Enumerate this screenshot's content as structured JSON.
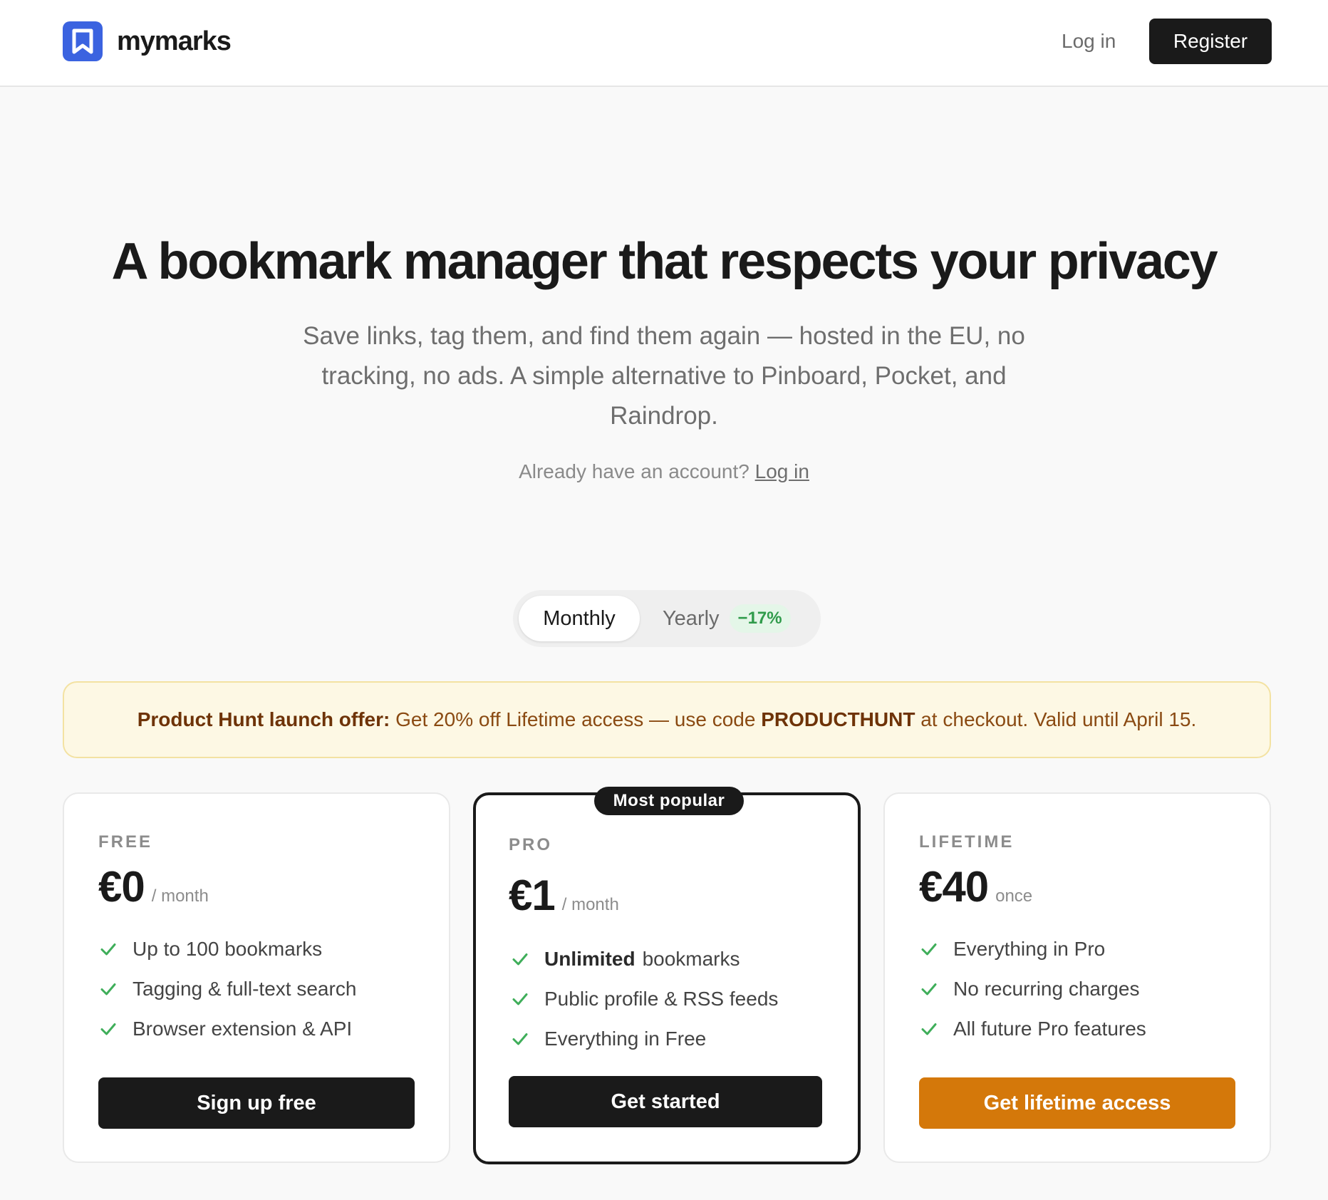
{
  "brand": {
    "name": "mymarks",
    "logo_color": "#3b63e0"
  },
  "nav": {
    "login_label": "Log in",
    "register_label": "Register"
  },
  "hero": {
    "title": "A bookmark manager that respects your privacy",
    "subtitle": "Save links, tag them, and find them again — hosted in the EU, no tracking, no ads. A simple alternative to Pinboard, Pocket, and Raindrop.",
    "account_prompt": "Already have an account?",
    "account_link": "Log in"
  },
  "billing_toggle": {
    "selected": "Monthly",
    "options": [
      {
        "label": "Monthly"
      },
      {
        "label": "Yearly",
        "badge": "−17%"
      }
    ]
  },
  "promo": {
    "lead": "Product Hunt launch offer:",
    "text_before_code": "Get 20% off Lifetime access — use code",
    "code": "PRODUCTHUNT",
    "text_after_code": "at checkout. Valid until April 15."
  },
  "plans": [
    {
      "name": "FREE",
      "price": "€0",
      "period": "/ month",
      "features": [
        {
          "text": "Up to 100 bookmarks"
        },
        {
          "text": "Tagging & full-text search"
        },
        {
          "text": "Browser extension & API"
        }
      ],
      "cta": "Sign up free",
      "cta_color": "#1a1a1a"
    },
    {
      "name": "PRO",
      "badge": "Most popular",
      "price": "€1",
      "period": "/ month",
      "features": [
        {
          "bold": "Unlimited",
          "text": "bookmarks"
        },
        {
          "text": "Public profile & RSS feeds"
        },
        {
          "text": "Everything in Free"
        }
      ],
      "cta": "Get started",
      "cta_color": "#1a1a1a"
    },
    {
      "name": "LIFETIME",
      "price": "€40",
      "period": "once",
      "features": [
        {
          "text": "Everything in Pro"
        },
        {
          "text": "No recurring charges"
        },
        {
          "text": "All future Pro features"
        }
      ],
      "cta": "Get lifetime access",
      "cta_color": "#d4780a"
    }
  ],
  "colors": {
    "check": "#3fae5a",
    "accent_orange": "#d4780a",
    "dark": "#1a1a1a"
  }
}
